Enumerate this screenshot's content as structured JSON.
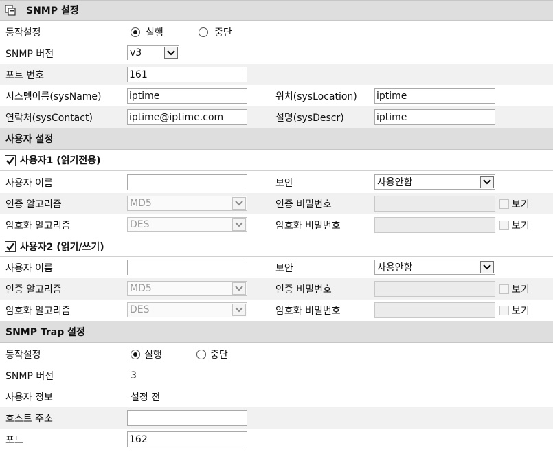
{
  "snmp": {
    "title": "SNMP 설정",
    "mode_label": "동작설정",
    "mode_on": "실행",
    "mode_off": "중단",
    "version_label": "SNMP 버전",
    "version_value": "v3",
    "port_label": "포트 번호",
    "port_value": "161",
    "sysname_label": "시스템이름(sysName)",
    "sysname_value": "iptime",
    "location_label": "위치(sysLocation)",
    "location_value": "iptime",
    "contact_label": "연락처(sysContact)",
    "contact_value": "iptime@iptime.com",
    "descr_label": "설명(sysDescr)",
    "descr_value": "iptime"
  },
  "users": {
    "title": "사용자 설정",
    "user1": {
      "title": "사용자1 (읽기전용)",
      "name_label": "사용자 이름",
      "name_value": "",
      "security_label": "보안",
      "security_value": "사용안함",
      "auth_algo_label": "인증 알고리즘",
      "auth_algo_value": "MD5",
      "auth_pw_label": "인증 비밀번호",
      "auth_show": "보기",
      "enc_algo_label": "암호화 알고리즘",
      "enc_algo_value": "DES",
      "enc_pw_label": "암호화 비밀번호",
      "enc_show": "보기"
    },
    "user2": {
      "title": "사용자2 (읽기/쓰기)",
      "name_label": "사용자 이름",
      "name_value": "",
      "security_label": "보안",
      "security_value": "사용안함",
      "auth_algo_label": "인증 알고리즘",
      "auth_algo_value": "MD5",
      "auth_pw_label": "인증 비밀번호",
      "auth_show": "보기",
      "enc_algo_label": "암호화 알고리즘",
      "enc_algo_value": "DES",
      "enc_pw_label": "암호화 비밀번호",
      "enc_show": "보기"
    }
  },
  "trap": {
    "title": "SNMP Trap 설정",
    "mode_label": "동작설정",
    "mode_on": "실행",
    "mode_off": "중단",
    "version_label": "SNMP 버전",
    "version_value": "3",
    "user_info_label": "사용자 정보",
    "user_info_value": "설정 전",
    "host_label": "호스트 주소",
    "host_value": "",
    "port_label": "포트",
    "port_value": "162"
  }
}
